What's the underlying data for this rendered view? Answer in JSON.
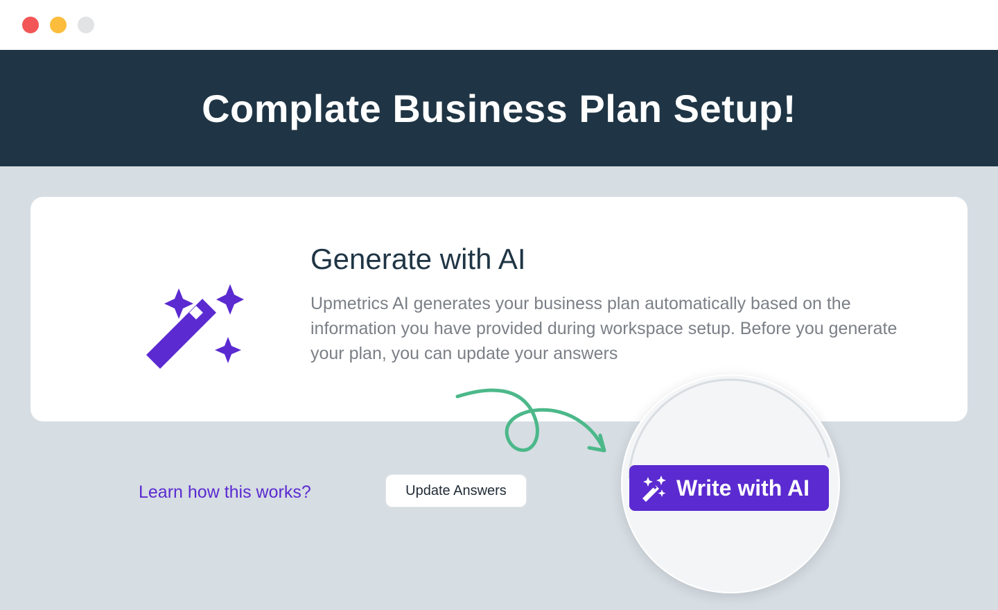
{
  "window": {
    "controls": [
      "close",
      "minimize",
      "maximize"
    ]
  },
  "header": {
    "title": "Complate Business Plan Setup!"
  },
  "card": {
    "icon": "magic-wand-icon",
    "title": "Generate with AI",
    "description": "Upmetrics AI generates your business plan automatically based on the information you have provided during workspace setup. Before you generate your plan, you can update your answers"
  },
  "actions": {
    "learn_link": "Learn how this works?",
    "update_button": "Update Answers",
    "ai_button": "Write with AI",
    "ai_button_icon": "magic-wand-icon"
  },
  "colors": {
    "header_bg": "#1f3545",
    "accent": "#5b2ad0",
    "arrow": "#4cb88a",
    "page_bg": "#d6dde3"
  }
}
